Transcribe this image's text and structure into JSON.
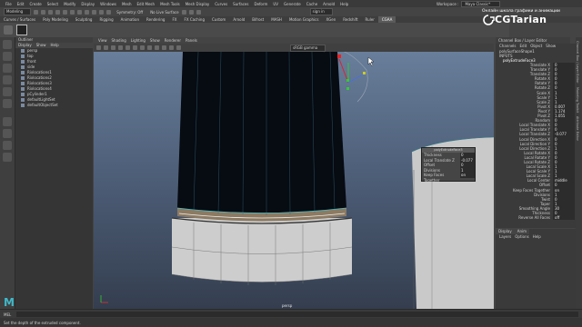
{
  "menus": [
    "File",
    "Edit",
    "Create",
    "Select",
    "Modify",
    "Display",
    "Windows",
    "Mesh",
    "Edit Mesh",
    "Mesh Tools",
    "Mesh Display",
    "Curves",
    "Surfaces",
    "Deform",
    "UV",
    "Generate",
    "Cache",
    "Arnold",
    "Help"
  ],
  "workspace": {
    "label": "Workspace :",
    "value": "Maya Classic*"
  },
  "statusline": {
    "mode": "Modeling",
    "symmetry": "Symmetry: Off",
    "live": "No Live Surface",
    "sign_in": "sign in"
  },
  "shelf_tabs": [
    "Curves / Surfaces",
    "Poly Modeling",
    "Sculpting",
    "Rigging",
    "Animation",
    "Rendering",
    "FX",
    "FX Caching",
    "Custom",
    "Arnold",
    "Bifrost",
    "MASH",
    "Motion Graphics",
    "XGen",
    "Redshift",
    "Ruler",
    "CGAA"
  ],
  "active_shelf": "CGAA",
  "logo": {
    "line1": "Онлайн школа графики и анимации",
    "line2": "CGTarian"
  },
  "outliner": {
    "title": "Outliner",
    "menu": [
      "Display",
      "Show",
      "Help"
    ],
    "items": [
      "persp",
      "top",
      "front",
      "side",
      "Rixlocations1",
      "Rixlocations2",
      "Rixlocations3",
      "Rixlocations4",
      "pCylinder1",
      "defaultLightSet",
      "defaultObjectSet"
    ]
  },
  "viewport": {
    "menu": [
      "View",
      "Shading",
      "Lighting",
      "Show",
      "Renderer",
      "Panels"
    ],
    "camera": "persp",
    "colorspace": "sRGB gamma"
  },
  "channelbox": {
    "tabs": [
      "Channel Box / Layer Editor",
      "Modeling Toolkit",
      "Attribute Editor"
    ],
    "menu": [
      "Channels",
      "Edit",
      "Object",
      "Show"
    ],
    "object": "polySurfaceShape1",
    "inputs_label": "INPUTS",
    "node": "polyExtrudeFace3",
    "channels": [
      {
        "n": "Translate X",
        "v": "0"
      },
      {
        "n": "Translate Y",
        "v": "0"
      },
      {
        "n": "Translate Z",
        "v": "0"
      },
      {
        "n": "Rotate X",
        "v": "0"
      },
      {
        "n": "Rotate Y",
        "v": "0"
      },
      {
        "n": "Rotate Z",
        "v": "0"
      },
      {
        "n": "Scale X",
        "v": "1"
      },
      {
        "n": "Scale Y",
        "v": "1"
      },
      {
        "n": "Scale Z",
        "v": "1"
      },
      {
        "n": "Pivot X",
        "v": "0.007"
      },
      {
        "n": "Pivot Y",
        "v": "1.174"
      },
      {
        "n": "Pivot Z",
        "v": "1.055"
      },
      {
        "n": "Random",
        "v": "0"
      },
      {
        "n": "Local Translate X",
        "v": "0"
      },
      {
        "n": "Local Translate Y",
        "v": "0"
      },
      {
        "n": "Local Translate Z",
        "v": "-0.077"
      },
      {
        "n": "Local Direction X",
        "v": "0"
      },
      {
        "n": "Local Direction Y",
        "v": "0"
      },
      {
        "n": "Local Direction Z",
        "v": "1"
      },
      {
        "n": "Local Rotate X",
        "v": "0"
      },
      {
        "n": "Local Rotate Y",
        "v": "0"
      },
      {
        "n": "Local Rotate Z",
        "v": "0"
      },
      {
        "n": "Local Scale X",
        "v": "1"
      },
      {
        "n": "Local Scale Y",
        "v": "1"
      },
      {
        "n": "Local Scale Z",
        "v": "1"
      },
      {
        "n": "Local Center",
        "v": "middle"
      },
      {
        "n": "Offset",
        "v": "0"
      },
      {
        "n": "Keep Faces Together",
        "v": "on"
      },
      {
        "n": "Divisions",
        "v": "1"
      },
      {
        "n": "Twist",
        "v": "0"
      },
      {
        "n": "Taper",
        "v": "1"
      },
      {
        "n": "Smoothing Angle",
        "v": "30"
      },
      {
        "n": "Thickness",
        "v": "0"
      },
      {
        "n": "Reverse All Faces",
        "v": "off"
      }
    ]
  },
  "layers": {
    "tabs": [
      "Display",
      "Anim"
    ],
    "menu": [
      "Layers",
      "Options",
      "Help"
    ]
  },
  "dialog": {
    "title": "polyExtrudeFace3",
    "rows": [
      {
        "n": "Thickness",
        "v": "0"
      },
      {
        "n": "Local Translate Z",
        "v": "-0.077"
      },
      {
        "n": "Offset",
        "v": "0"
      },
      {
        "n": "Divisions",
        "v": "1"
      },
      {
        "n": "Keep Faces Together",
        "v": "on"
      }
    ]
  },
  "cmdline": {
    "label": "MEL"
  },
  "helpline": {
    "text": "Set the depth of the extruded component."
  },
  "colors": {
    "accent": "#3fb8c9",
    "viewport_top": "#687e9a",
    "viewport_bottom": "#343e4f",
    "cylinder_dark": "#070b12",
    "wire": "#2f7e8a"
  }
}
